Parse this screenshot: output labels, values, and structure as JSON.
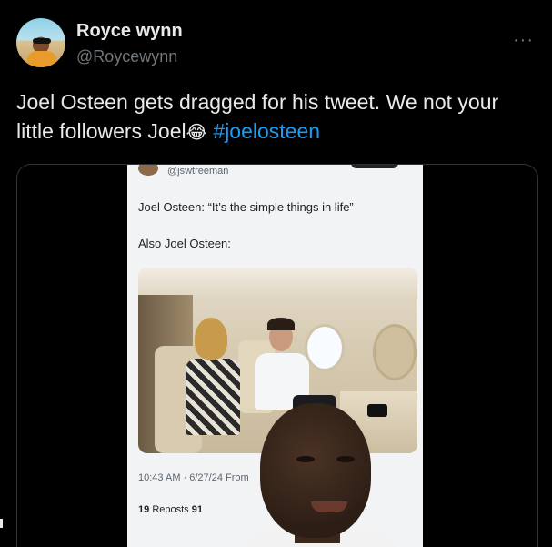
{
  "header": {
    "name": "Royce wynn",
    "handle": "@Roycewynn",
    "more": "···"
  },
  "tweet": {
    "text_before_emoji": "Joel Osteen gets dragged for his tweet.  We not your little followers Joel",
    "emoji": "😂",
    "hashtag": "#joelosteen"
  },
  "embedded": {
    "handle": "@jswtreeman",
    "line1": "Joel Osteen: “It’s the simple things in life”",
    "line2": "Also Joel Osteen:",
    "meta": "10:43 AM · 6/27/24 From",
    "reposts_count": "19",
    "reposts_label": "Reposts",
    "likes_partial": "91"
  },
  "colors": {
    "background": "#000000",
    "text": "#e7e9ea",
    "secondary": "#71767b",
    "hashtag": "#1d9bf0"
  }
}
